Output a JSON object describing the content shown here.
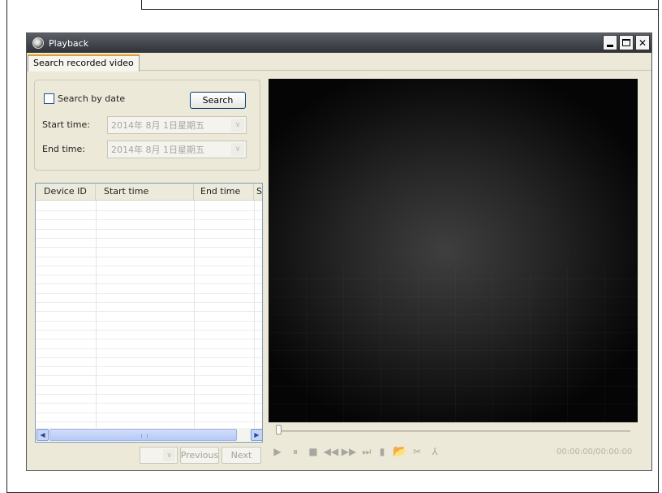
{
  "window": {
    "title": "Playback",
    "controls": {
      "minimize": "_",
      "maximize": "□",
      "close": "✕"
    }
  },
  "tab": {
    "label": "Search recorded video"
  },
  "search": {
    "checkbox_label": "Search by date",
    "search_button": "Search",
    "start_label": "Start time:",
    "start_value": "2014年  8月  1日星期五",
    "end_label": "End time:",
    "end_value": "2014年  8月  1日星期五",
    "combo_arrow": "∨"
  },
  "table": {
    "columns": [
      "Device ID",
      "Start time",
      "End time",
      "S"
    ],
    "rows": []
  },
  "pagination": {
    "page_value": "",
    "previous": "Previous",
    "next": "Next"
  },
  "player": {
    "position": 0.0,
    "time": "00:00:00/00:00:00",
    "controls": [
      {
        "name": "play-icon",
        "glyph": "▶"
      },
      {
        "name": "pause-icon",
        "glyph": "⏸"
      },
      {
        "name": "stop-icon",
        "glyph": "■"
      },
      {
        "name": "rewind-icon",
        "glyph": "◀◀"
      },
      {
        "name": "fast-forward-icon",
        "glyph": "▶▶"
      },
      {
        "name": "step-frame-icon",
        "glyph": "⏭"
      },
      {
        "name": "snapshot-icon",
        "glyph": "▮"
      },
      {
        "name": "open-folder-icon",
        "glyph": "📂"
      },
      {
        "name": "clip-start-icon",
        "glyph": "✂"
      },
      {
        "name": "clip-end-icon",
        "glyph": "⅄"
      }
    ]
  },
  "colors": {
    "titlebar": "#3e4147",
    "tab_accent": "#e59b29",
    "face": "#ece9d8"
  }
}
